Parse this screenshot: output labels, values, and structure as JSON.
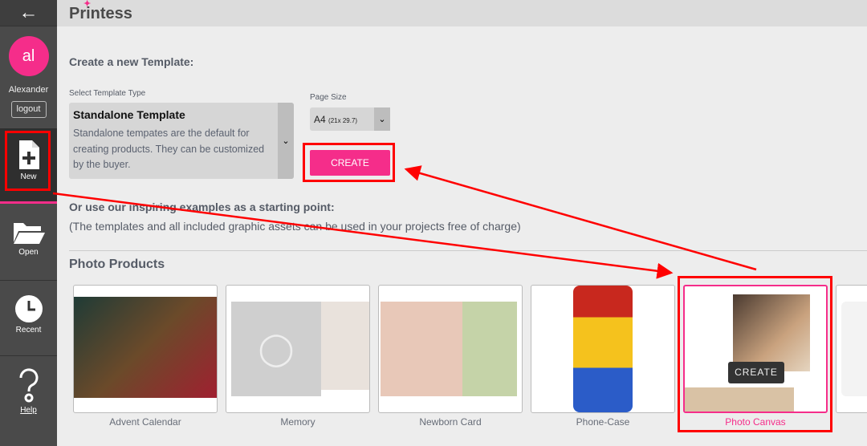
{
  "sidebar": {
    "back_icon": "arrow-left-icon",
    "avatar_initials": "al",
    "user_name": "Alexander",
    "logout_label": "logout",
    "items": [
      {
        "label": "New",
        "icon": "file-plus-icon"
      },
      {
        "label": "Open",
        "icon": "folder-open-icon"
      },
      {
        "label": "Recent",
        "icon": "clock-icon"
      },
      {
        "label": "Help",
        "icon": "question-icon"
      }
    ]
  },
  "header": {
    "logo": "Printess"
  },
  "main": {
    "heading": "Create a new Template:",
    "template_type": {
      "label": "Select Template Type",
      "title": "Standalone Template",
      "description": "Standalone tempates are the default for creating products. They can be customized by the buyer."
    },
    "page_size": {
      "label": "Page Size",
      "value": "A4",
      "detail": "(21x 29.7)"
    },
    "create_label": "CREATE",
    "examples_heading": "Or use our inspiring examples as a starting point:",
    "examples_note": "(The templates and all included graphic assets can be used in your projects free of charge)",
    "section_title": "Photo Products",
    "cards": [
      {
        "label": "Advent Calendar"
      },
      {
        "label": "Memory"
      },
      {
        "label": "Newborn Card"
      },
      {
        "label": "Phone-Case"
      },
      {
        "label": "Photo Canvas",
        "hover_label": "CREATE"
      },
      {
        "label": ""
      }
    ]
  },
  "colors": {
    "accent": "#f52d8a",
    "annotation": "#ff0000"
  }
}
